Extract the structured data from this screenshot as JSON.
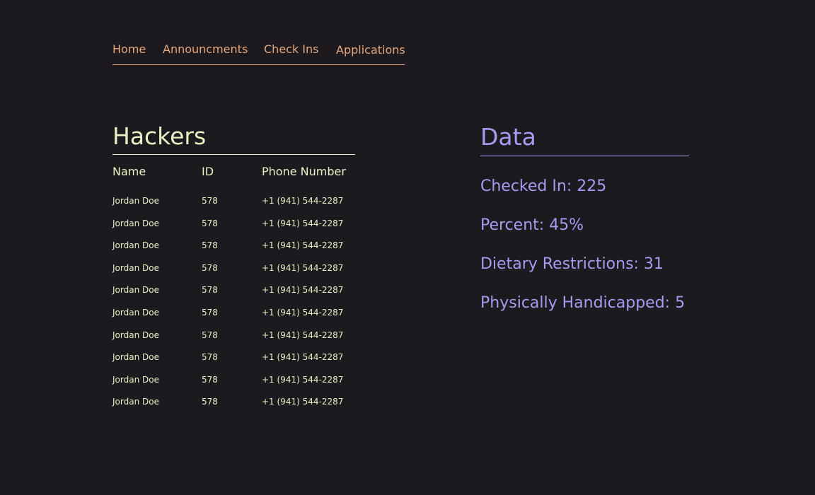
{
  "nav": {
    "items": [
      "Home",
      "Announcments",
      "Check Ins",
      "Applications"
    ]
  },
  "hackers": {
    "title": "Hackers",
    "columns": [
      "Name",
      "ID",
      "Phone Number"
    ],
    "rows": [
      {
        "name": "Jordan Doe",
        "id": "578",
        "phone": "+1 (941) 544-2287"
      },
      {
        "name": "Jordan Doe",
        "id": "578",
        "phone": "+1 (941) 544-2287"
      },
      {
        "name": "Jordan Doe",
        "id": "578",
        "phone": "+1 (941) 544-2287"
      },
      {
        "name": "Jordan Doe",
        "id": "578",
        "phone": "+1 (941) 544-2287"
      },
      {
        "name": "Jordan Doe",
        "id": "578",
        "phone": "+1 (941) 544-2287"
      },
      {
        "name": "Jordan Doe",
        "id": "578",
        "phone": "+1 (941) 544-2287"
      },
      {
        "name": "Jordan Doe",
        "id": "578",
        "phone": "+1 (941) 544-2287"
      },
      {
        "name": "Jordan Doe",
        "id": "578",
        "phone": "+1 (941) 544-2287"
      },
      {
        "name": "Jordan Doe",
        "id": "578",
        "phone": "+1 (941) 544-2287"
      },
      {
        "name": "Jordan Doe",
        "id": "578",
        "phone": "+1 (941) 544-2287"
      }
    ]
  },
  "data": {
    "title": "Data",
    "stats": [
      "Checked In: 225",
      "Percent: 45%",
      "Dietary Restrictions: 31",
      "Physically Handicapped: 5"
    ]
  },
  "colors": {
    "background": "#1c1a1f",
    "nav": "#e8a77a",
    "hackers": "#e4f3c4",
    "data": "#a89af0"
  }
}
